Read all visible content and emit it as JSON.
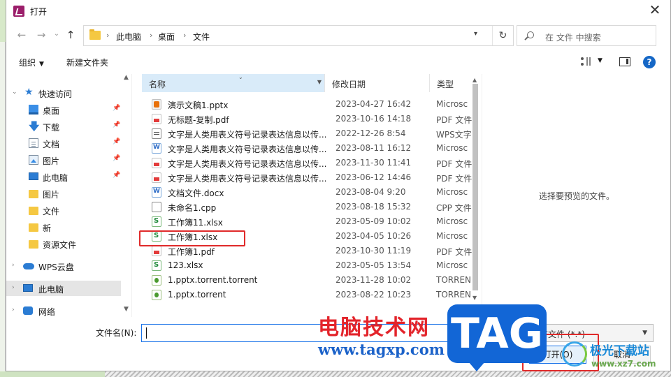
{
  "window": {
    "title": "打开",
    "close_glyph": "✕"
  },
  "nav": {
    "back_glyph": "←",
    "forward_glyph": "→",
    "recent_glyph": "⌄",
    "up_glyph": "↑",
    "breadcrumb": [
      "此电脑",
      "桌面",
      "文件"
    ],
    "refresh_glyph": "↻",
    "search_placeholder": "在 文件 中搜索"
  },
  "toolbar": {
    "organize": "组织",
    "new_folder": "新建文件夹"
  },
  "sidebar": {
    "items": [
      {
        "label": "快速访问",
        "icon": "star-icon"
      },
      {
        "label": "桌面",
        "icon": "desktop-icon",
        "pinned": true
      },
      {
        "label": "下载",
        "icon": "download-icon",
        "pinned": true
      },
      {
        "label": "文档",
        "icon": "document-icon",
        "pinned": true
      },
      {
        "label": "图片",
        "icon": "picture-icon",
        "pinned": true
      },
      {
        "label": "此电脑",
        "icon": "computer-icon",
        "pinned": true
      },
      {
        "label": "图片",
        "icon": "folder-icon"
      },
      {
        "label": "文件",
        "icon": "folder-icon"
      },
      {
        "label": "新",
        "icon": "folder-icon"
      },
      {
        "label": "资源文件",
        "icon": "folder-icon"
      },
      {
        "label": "WPS云盘",
        "icon": "cloud-icon"
      },
      {
        "label": "此电脑",
        "icon": "computer-icon",
        "selected": true
      },
      {
        "label": "网络",
        "icon": "network-icon"
      }
    ]
  },
  "file_list": {
    "columns": {
      "name": "名称",
      "date": "修改日期",
      "type": "类型"
    },
    "rows": [
      {
        "name": "演示文稿1.pptx",
        "date": "2023-04-27 16:42",
        "type": "Microsc",
        "icon": "ppt"
      },
      {
        "name": "无标题-复制.pdf",
        "date": "2023-10-16 14:18",
        "type": "PDF 文件",
        "icon": "pdf"
      },
      {
        "name": "文字是人类用表义符号记录表达信息以传...",
        "date": "2022-12-26 8:54",
        "type": "WPS文字",
        "icon": "wps"
      },
      {
        "name": "文字是人类用表义符号记录表达信息以传...",
        "date": "2023-08-11 16:12",
        "type": "Microsc",
        "icon": "word"
      },
      {
        "name": "文字是人类用表义符号记录表达信息以传...",
        "date": "2023-11-30 11:41",
        "type": "PDF 文件",
        "icon": "pdf"
      },
      {
        "name": "文字是人类用表义符号记录表达信息以传...",
        "date": "2023-06-12 14:46",
        "type": "PDF 文件",
        "icon": "pdf"
      },
      {
        "name": "文档文件.docx",
        "date": "2023-08-04 9:20",
        "type": "Microsc",
        "icon": "word"
      },
      {
        "name": "未命名1.cpp",
        "date": "2023-08-18 15:32",
        "type": "CPP 文件",
        "icon": "txt"
      },
      {
        "name": "工作簿11.xlsx",
        "date": "2023-05-09 10:02",
        "type": "Microsc",
        "icon": "xls"
      },
      {
        "name": "工作簿1.xlsx",
        "date": "2023-04-05 10:26",
        "type": "Microsc",
        "icon": "xls",
        "highlighted": true
      },
      {
        "name": "工作簿1.pdf",
        "date": "2023-10-30 11:19",
        "type": "PDF 文件",
        "icon": "pdf"
      },
      {
        "name": "123.xlsx",
        "date": "2023-05-05 13:54",
        "type": "Microsc",
        "icon": "xls"
      },
      {
        "name": "1.pptx.torrent.torrent",
        "date": "2023-11-28 10:02",
        "type": "TORREN",
        "icon": "torrent"
      },
      {
        "name": "1.pptx.torrent",
        "date": "2023-08-22 10:23",
        "type": "TORREN",
        "icon": "torrent"
      }
    ]
  },
  "preview": {
    "empty_text": "选择要预览的文件。"
  },
  "bottom": {
    "filename_label": "文件名(N):",
    "filename_value": "",
    "filter_value": "所有文件 (*.*)",
    "open_label": "打开(O)",
    "cancel_label": "取消"
  },
  "watermark": {
    "site_title": "电脑技术网",
    "site_url": "www.tagxp.com",
    "tag": "TAG",
    "xz_title": "极光下载站",
    "xz_url": "www.xz7.com"
  },
  "colors": {
    "accent": "#1a73e8",
    "highlight_red": "#e02a2a",
    "selection": "#e5e5e5",
    "header_sort": "#d9ebf9"
  }
}
